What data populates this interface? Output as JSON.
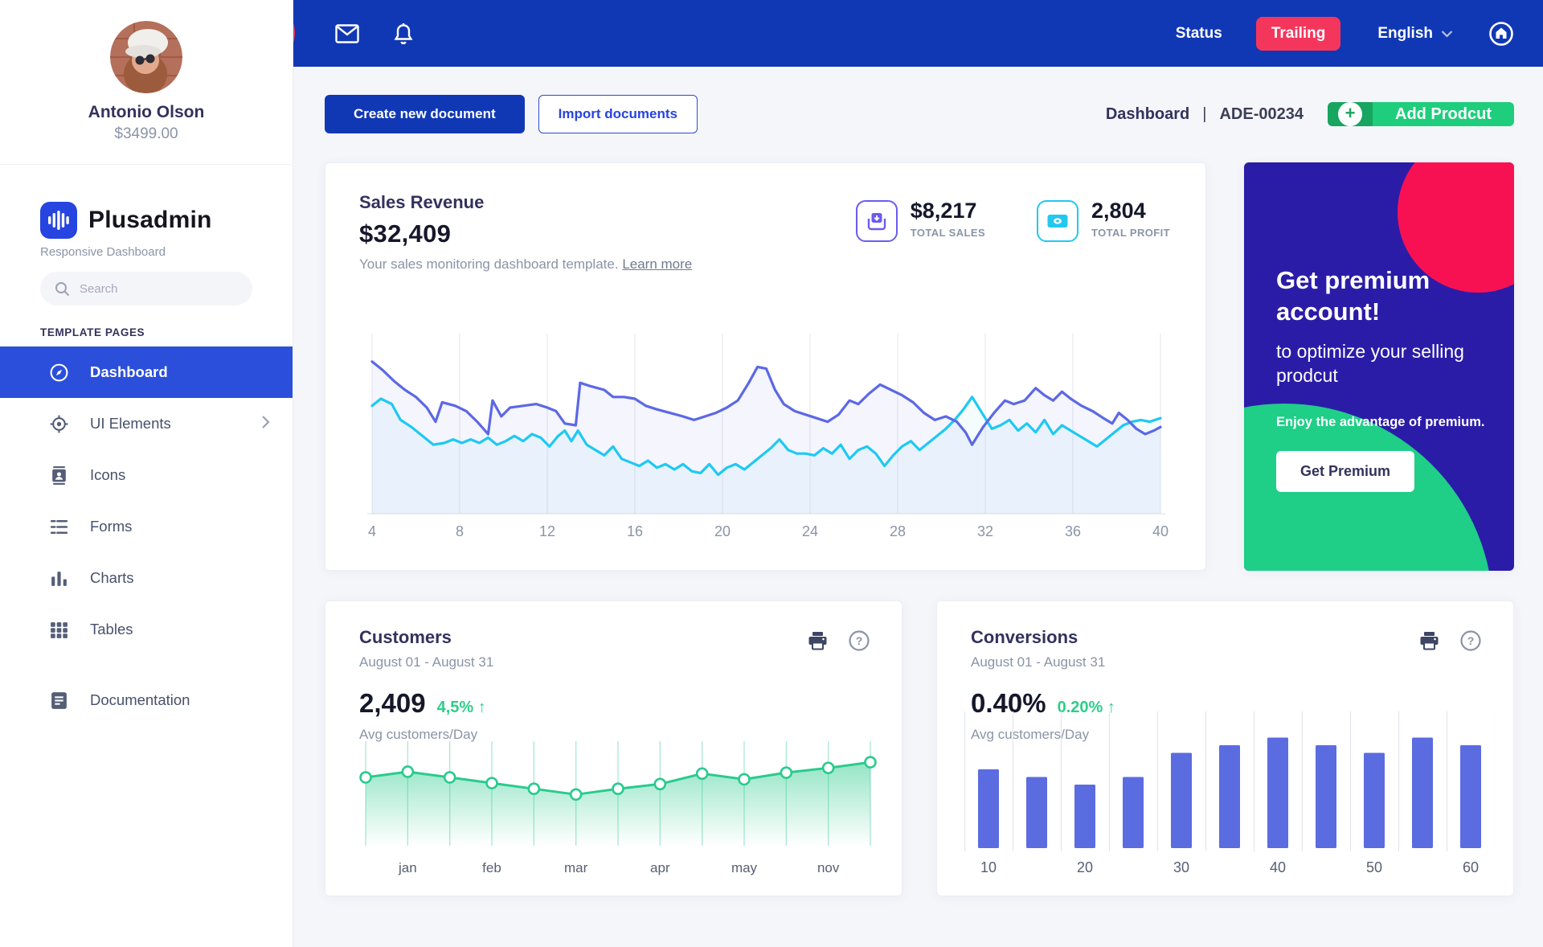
{
  "sidebar": {
    "profile": {
      "name": "Antonio Olson",
      "balance": "$3499.00"
    },
    "brand": {
      "name": "Plusadmin",
      "tagline": "Responsive Dashboard"
    },
    "search": {
      "placeholder": "Search"
    },
    "section_label": "TEMPLATE PAGES",
    "items": [
      {
        "label": "Dashboard",
        "icon": "compass-icon",
        "active": true
      },
      {
        "label": "UI Elements",
        "icon": "target-icon",
        "has_submenu": true
      },
      {
        "label": "Icons",
        "icon": "id-card-icon"
      },
      {
        "label": "Forms",
        "icon": "list-icon"
      },
      {
        "label": "Charts",
        "icon": "bar-chart-icon"
      },
      {
        "label": "Tables",
        "icon": "grid-icon"
      },
      {
        "label": "Documentation",
        "icon": "document-icon"
      }
    ]
  },
  "topbar": {
    "collapse_glyph": "«",
    "status_label": "Status",
    "trailing_label": "Trailing",
    "language": "English"
  },
  "header": {
    "create_button": "Create new document",
    "import_button": "Import documents",
    "breadcrumb": {
      "section": "Dashboard",
      "separator": "|",
      "code": "ADE-00234"
    },
    "add_button": "Add Prodcut",
    "add_plus_glyph": "+"
  },
  "sales_card": {
    "title": "Sales Revenue",
    "amount": "$32,409",
    "subtitle": "Your sales monitoring dashboard template.",
    "link": "Learn more",
    "stats": [
      {
        "value": "$8,217",
        "label": "TOTAL SALES",
        "icon": "inbox-save-icon",
        "color": "#6a5cf0"
      },
      {
        "value": "2,804",
        "label": "TOTAL PROFIT",
        "icon": "banknote-icon",
        "color": "#22c8f0"
      }
    ]
  },
  "premium_card": {
    "title": "Get premium account!",
    "subtitle": "to optimize your selling prodcut",
    "note": "Enjoy the advantage of premium.",
    "button": "Get Premium",
    "bg_color": "#2b1ca8",
    "pink_circle": "#f81152",
    "green_circle": "#1fce87"
  },
  "customers_card": {
    "title": "Customers",
    "period": "August 01 - August 31",
    "value": "2,409",
    "delta": "4,5%",
    "delta_arrow": "↑",
    "caption": "Avg customers/Day"
  },
  "conversions_card": {
    "title": "Conversions",
    "period": "August 01 - August 31",
    "value": "0.40%",
    "delta": "0.20%",
    "delta_arrow": "↑",
    "caption": "Avg customers/Day"
  },
  "colors": {
    "topbar_blue": "#1138b4",
    "active_nav_blue": "#2b4fdb",
    "collapse_red": "#eb3a55",
    "trailing_pink": "#f5365c",
    "add_green": "#1fce7c",
    "add_green_dark": "#17a55f",
    "line_purple": "#5c68e6",
    "line_cyan": "#1ec9f2",
    "area_green": "#29cb8d",
    "bar_indigo": "#5b6ce0",
    "delta_green": "#2dce89"
  },
  "chart_data": [
    {
      "id": "sales-revenue-line",
      "type": "line",
      "title": "Sales Revenue",
      "x_ticks": [
        4,
        8,
        12,
        16,
        20,
        24,
        28,
        32,
        36,
        40
      ],
      "x_range": [
        4,
        40
      ],
      "ylim": [
        0,
        100
      ],
      "grid": "vertical",
      "legend_position": "none",
      "series": [
        {
          "name": "revenue",
          "color": "#5c68e6",
          "fill": "rgba(99,112,230,0.07)",
          "points": [
            [
              4,
              86
            ],
            [
              4.5,
              81
            ],
            [
              5,
              75
            ],
            [
              5.5,
              70
            ],
            [
              6,
              66
            ],
            [
              6.5,
              60
            ],
            [
              6.9,
              52
            ],
            [
              7.2,
              63
            ],
            [
              7.8,
              61
            ],
            [
              8.3,
              58
            ],
            [
              8.8,
              52
            ],
            [
              9.3,
              45
            ],
            [
              9.5,
              64
            ],
            [
              9.9,
              55
            ],
            [
              10.3,
              60
            ],
            [
              10.9,
              61
            ],
            [
              11.5,
              62
            ],
            [
              12,
              60
            ],
            [
              12.4,
              58
            ],
            [
              12.8,
              51
            ],
            [
              13.3,
              50
            ],
            [
              13.5,
              74
            ],
            [
              14,
              72
            ],
            [
              14.6,
              70
            ],
            [
              15,
              66
            ],
            [
              15.5,
              66
            ],
            [
              16,
              65
            ],
            [
              16.5,
              61
            ],
            [
              17,
              59
            ],
            [
              17.6,
              57
            ],
            [
              18.2,
              55
            ],
            [
              18.7,
              53
            ],
            [
              19.2,
              55
            ],
            [
              19.7,
              57
            ],
            [
              20.2,
              60
            ],
            [
              20.7,
              64
            ],
            [
              21.2,
              74
            ],
            [
              21.6,
              83
            ],
            [
              22,
              82
            ],
            [
              22.4,
              70
            ],
            [
              22.8,
              62
            ],
            [
              23.3,
              58
            ],
            [
              23.8,
              56
            ],
            [
              24.3,
              54
            ],
            [
              24.8,
              52
            ],
            [
              25.3,
              56
            ],
            [
              25.8,
              64
            ],
            [
              26.2,
              62
            ],
            [
              26.7,
              68
            ],
            [
              27.2,
              73
            ],
            [
              27.7,
              70
            ],
            [
              28.2,
              67
            ],
            [
              28.7,
              63
            ],
            [
              29.2,
              57
            ],
            [
              29.7,
              53
            ],
            [
              30.2,
              55
            ],
            [
              30.7,
              52
            ],
            [
              31.1,
              46
            ],
            [
              31.4,
              39
            ],
            [
              31.9,
              49
            ],
            [
              32.4,
              57
            ],
            [
              32.9,
              64
            ],
            [
              33.3,
              62
            ],
            [
              33.8,
              64
            ],
            [
              34.3,
              71
            ],
            [
              34.7,
              67
            ],
            [
              35.1,
              64
            ],
            [
              35.5,
              69
            ],
            [
              35.9,
              65
            ],
            [
              36.4,
              61
            ],
            [
              36.9,
              58
            ],
            [
              37.4,
              54
            ],
            [
              37.8,
              51
            ],
            [
              38.1,
              57
            ],
            [
              38.5,
              53
            ],
            [
              38.9,
              48
            ],
            [
              39.3,
              45
            ],
            [
              39.7,
              47
            ],
            [
              40,
              49
            ]
          ]
        },
        {
          "name": "profit",
          "color": "#1ec9f2",
          "fill": "rgba(30,201,242,0.05)",
          "points": [
            [
              4,
              61
            ],
            [
              4.4,
              65
            ],
            [
              4.9,
              62
            ],
            [
              5.3,
              53
            ],
            [
              5.8,
              49
            ],
            [
              6.3,
              44
            ],
            [
              6.8,
              39
            ],
            [
              7.3,
              40
            ],
            [
              7.7,
              42
            ],
            [
              8.1,
              40
            ],
            [
              8.5,
              42
            ],
            [
              8.9,
              40
            ],
            [
              9.3,
              43
            ],
            [
              9.7,
              39
            ],
            [
              10.1,
              41
            ],
            [
              10.5,
              44
            ],
            [
              10.9,
              41
            ],
            [
              11.3,
              45
            ],
            [
              11.7,
              43
            ],
            [
              12.1,
              38
            ],
            [
              12.5,
              44
            ],
            [
              12.8,
              47
            ],
            [
              13.1,
              41
            ],
            [
              13.4,
              47
            ],
            [
              13.8,
              39
            ],
            [
              14.2,
              36
            ],
            [
              14.6,
              33
            ],
            [
              15,
              38
            ],
            [
              15.4,
              31
            ],
            [
              15.8,
              29
            ],
            [
              16.2,
              27
            ],
            [
              16.6,
              30
            ],
            [
              17,
              26
            ],
            [
              17.4,
              28
            ],
            [
              17.8,
              25
            ],
            [
              18.2,
              28
            ],
            [
              18.6,
              24
            ],
            [
              19,
              23
            ],
            [
              19.4,
              28
            ],
            [
              19.8,
              22
            ],
            [
              20.2,
              26
            ],
            [
              20.6,
              28
            ],
            [
              21,
              25
            ],
            [
              21.4,
              29
            ],
            [
              21.8,
              33
            ],
            [
              22.2,
              37
            ],
            [
              22.6,
              42
            ],
            [
              23,
              36
            ],
            [
              23.4,
              34
            ],
            [
              23.8,
              34
            ],
            [
              24.2,
              33
            ],
            [
              24.6,
              37
            ],
            [
              25,
              34
            ],
            [
              25.4,
              39
            ],
            [
              25.8,
              31
            ],
            [
              26.2,
              36
            ],
            [
              26.6,
              38
            ],
            [
              27,
              34
            ],
            [
              27.4,
              27
            ],
            [
              27.8,
              33
            ],
            [
              28.2,
              38
            ],
            [
              28.6,
              41
            ],
            [
              29,
              36
            ],
            [
              29.4,
              40
            ],
            [
              29.8,
              44
            ],
            [
              30.2,
              48
            ],
            [
              30.6,
              53
            ],
            [
              31,
              59
            ],
            [
              31.4,
              66
            ],
            [
              31.9,
              56
            ],
            [
              32.3,
              48
            ],
            [
              32.7,
              50
            ],
            [
              33.1,
              53
            ],
            [
              33.5,
              47
            ],
            [
              33.9,
              51
            ],
            [
              34.3,
              46
            ],
            [
              34.7,
              53
            ],
            [
              35.1,
              45
            ],
            [
              35.5,
              50
            ],
            [
              35.9,
              47
            ],
            [
              36.3,
              44
            ],
            [
              36.7,
              41
            ],
            [
              37.1,
              38
            ],
            [
              37.5,
              42
            ],
            [
              37.9,
              46
            ],
            [
              38.3,
              50
            ],
            [
              38.7,
              52
            ],
            [
              39.1,
              53
            ],
            [
              39.5,
              52
            ],
            [
              40,
              54
            ]
          ]
        }
      ]
    },
    {
      "id": "customers-area",
      "type": "area",
      "title": "Customers — Avg customers/Day",
      "values": [
        72,
        78,
        72,
        66,
        60,
        54,
        60,
        65,
        76,
        70,
        77,
        82,
        88
      ],
      "values_unit": "relative-%",
      "labels": [
        "jan",
        "feb",
        "mar",
        "apr",
        "may",
        "nov"
      ],
      "label_indexes": [
        1,
        3,
        5,
        7,
        9,
        11
      ],
      "color": "#29cb8d",
      "tick_color": "#a9e9d2",
      "marker": "open-circle"
    },
    {
      "id": "conversions-bar",
      "type": "bar",
      "title": "Conversions — Avg customers/Day",
      "values": [
        62,
        56,
        50,
        56,
        75,
        81,
        87,
        81,
        75,
        87,
        81
      ],
      "values_unit": "relative-%",
      "labels": [
        "10",
        "20",
        "30",
        "40",
        "50",
        "60"
      ],
      "label_indexes": [
        0,
        2,
        4,
        6,
        8,
        10
      ],
      "color": "#5b6ce0",
      "grid_color": "#e4e6ec"
    }
  ]
}
